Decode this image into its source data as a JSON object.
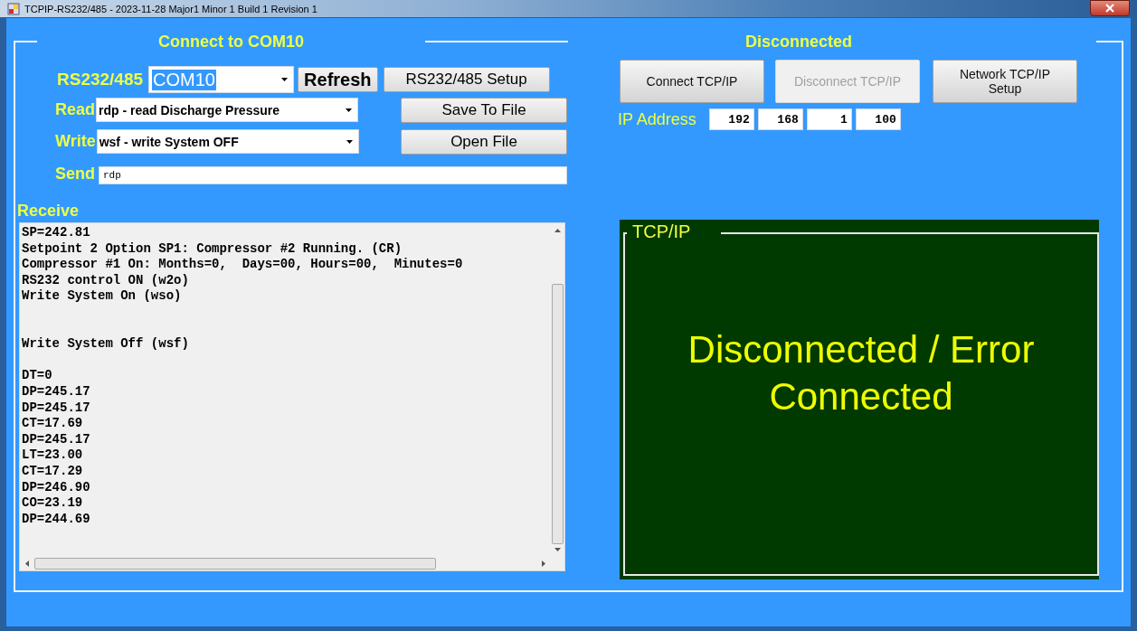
{
  "window": {
    "title": "TCPIP-RS232/485 - 2023-11-28 Major1 Minor 1 Build 1 Revision 1"
  },
  "serial": {
    "title": "Connect to COM10",
    "port_label": "RS232/485",
    "port_value": "COM10",
    "port_highlighted": true,
    "refresh": "Refresh",
    "setup": "RS232/485 Setup",
    "read_label": "Read",
    "read_value": "rdp - read Discharge Pressure",
    "write_label": "Write",
    "write_value": "wsf - write System OFF",
    "save": "Save To File",
    "open": "Open File",
    "send_label": "Send",
    "send_value": "rdp",
    "receive_label": "Receive",
    "receive_text": "SP=242.81\nSetpoint 2 Option SP1: Compressor #2 Running. (CR)\nCompressor #1 On: Months=0,  Days=00, Hours=00,  Minutes=0\nRS232 control ON (w2o)\nWrite System On (wso)\n\n\nWrite System Off (wsf)\n\nDT=0\nDP=245.17\nDP=245.17\nCT=17.69\nDP=245.17\nLT=23.00\nCT=17.29\nDP=246.90\nCO=23.19\nDP=244.69"
  },
  "tcp": {
    "title": "Disconnected",
    "buttons": [
      {
        "label": "Connect TCP/IP",
        "disabled": false
      },
      {
        "label": "Disconnect TCP/IP",
        "disabled": true
      },
      {
        "label": "Network TCP/IP Setup",
        "disabled": false
      }
    ],
    "ip_label": "IP Address",
    "ip": [
      "192",
      "168",
      "1",
      "100"
    ],
    "panel_title": "TCP/IP",
    "status_lines": [
      "Disconnected / Error",
      "Connected"
    ]
  }
}
